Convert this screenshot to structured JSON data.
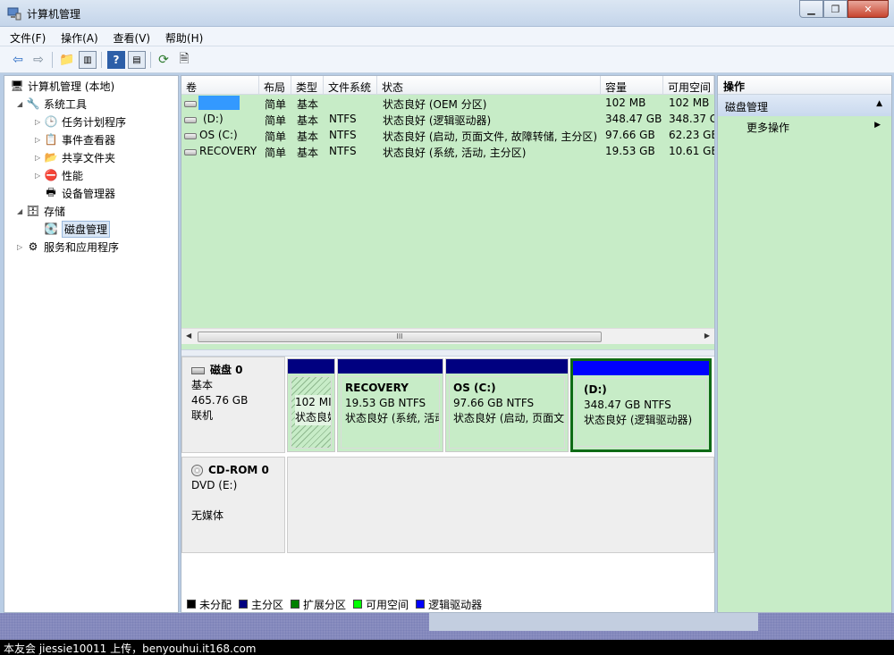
{
  "window": {
    "title": "计算机管理"
  },
  "menu": [
    "文件(F)",
    "操作(A)",
    "查看(V)",
    "帮助(H)"
  ],
  "tree": {
    "root": "计算机管理 (本地)",
    "system_tools": "系统工具",
    "task_scheduler": "任务计划程序",
    "event_viewer": "事件查看器",
    "shared_folders": "共享文件夹",
    "performance": "性能",
    "device_manager": "设备管理器",
    "storage": "存储",
    "disk_management": "磁盘管理",
    "services_apps": "服务和应用程序"
  },
  "columns": [
    "卷",
    "布局",
    "类型",
    "文件系统",
    "状态",
    "容量",
    "可用空间"
  ],
  "volumes": [
    {
      "name": "",
      "layout": "简单",
      "type": "基本",
      "fs": "",
      "status": "状态良好 (OEM 分区)",
      "capacity": "102 MB",
      "free": "102 MB"
    },
    {
      "name": "(D:)",
      "layout": "简单",
      "type": "基本",
      "fs": "NTFS",
      "status": "状态良好 (逻辑驱动器)",
      "capacity": "348.47 GB",
      "free": "348.37 G"
    },
    {
      "name": "OS (C:)",
      "layout": "简单",
      "type": "基本",
      "fs": "NTFS",
      "status": "状态良好 (启动, 页面文件, 故障转储, 主分区)",
      "capacity": "97.66 GB",
      "free": "62.23 GE"
    },
    {
      "name": "RECOVERY",
      "layout": "简单",
      "type": "基本",
      "fs": "NTFS",
      "status": "状态良好 (系统, 活动, 主分区)",
      "capacity": "19.53 GB",
      "free": "10.61 GE"
    }
  ],
  "scroll_grip": "III",
  "disk0": {
    "name": "磁盘 0",
    "type": "基本",
    "size": "465.76 GB",
    "state": "联机",
    "partitions": [
      {
        "title": "",
        "line1": "102 MI",
        "line2": "状态良妇"
      },
      {
        "title": "RECOVERY",
        "line1": "19.53 GB NTFS",
        "line2": "状态良好 (系统, 活动"
      },
      {
        "title": "OS  (C:)",
        "line1": "97.66 GB NTFS",
        "line2": "状态良好 (启动, 页面文"
      },
      {
        "title": "(D:)",
        "line1": "348.47 GB NTFS",
        "line2": "状态良好 (逻辑驱动器)"
      }
    ]
  },
  "cdrom": {
    "name": "CD-ROM 0",
    "drive": "DVD (E:)",
    "media": "无媒体"
  },
  "legend": [
    {
      "label": "未分配",
      "color": "#000000"
    },
    {
      "label": "主分区",
      "color": "#000080"
    },
    {
      "label": "扩展分区",
      "color": "#008000"
    },
    {
      "label": "可用空间",
      "color": "#00ff00"
    },
    {
      "label": "逻辑驱动器",
      "color": "#0000ff"
    }
  ],
  "actions": {
    "header": "操作",
    "section": "磁盘管理",
    "more": "更多操作"
  },
  "watermark": "本友会 jiessie10011 上传，benyouhui.it168.com"
}
